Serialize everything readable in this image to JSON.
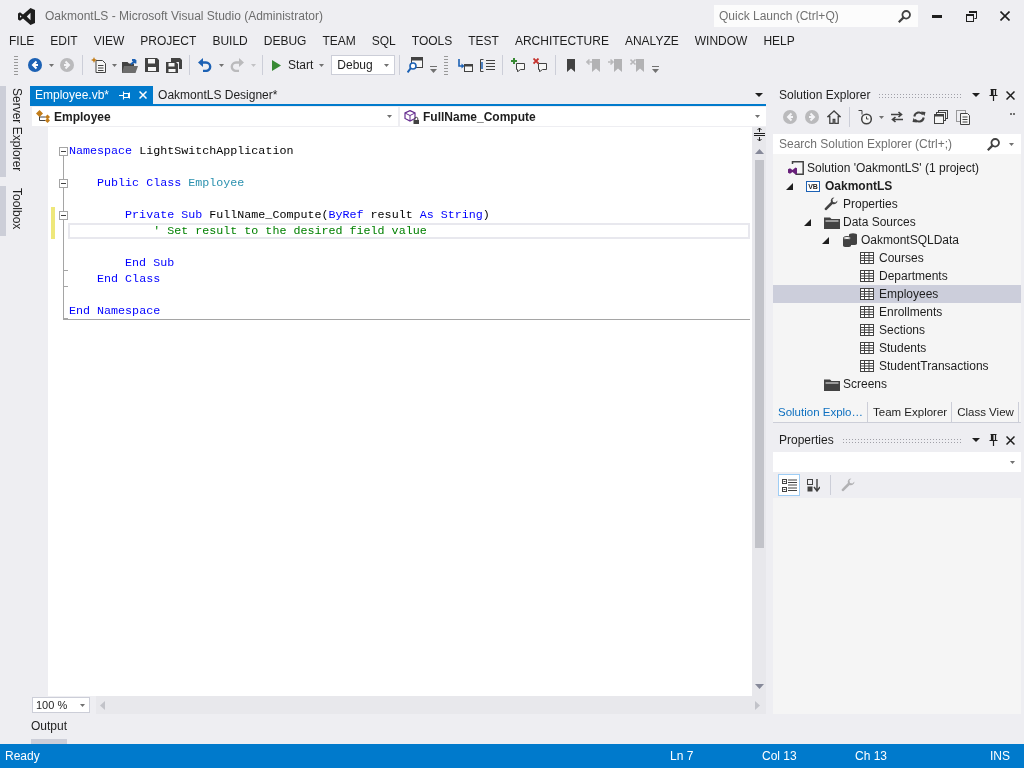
{
  "window": {
    "title": "OakmontLS - Microsoft Visual Studio (Administrator)"
  },
  "quick_launch": {
    "placeholder": "Quick Launch (Ctrl+Q)"
  },
  "menu": [
    "FILE",
    "EDIT",
    "VIEW",
    "PROJECT",
    "BUILD",
    "DEBUG",
    "TEAM",
    "SQL",
    "TOOLS",
    "TEST",
    "ARCHITECTURE",
    "ANALYZE",
    "WINDOW",
    "HELP"
  ],
  "toolbar": [
    {
      "kind": "grip"
    },
    {
      "kind": "back",
      "disabled": false
    },
    {
      "kind": "caret",
      "disabled": false
    },
    {
      "kind": "forward",
      "disabled": true
    },
    {
      "kind": "separator"
    },
    {
      "kind": "new_project",
      "disabled": false
    },
    {
      "kind": "caret",
      "disabled": false
    },
    {
      "kind": "open_file",
      "disabled": false
    },
    {
      "kind": "save",
      "disabled": false
    },
    {
      "kind": "save_all",
      "disabled": false
    },
    {
      "kind": "separator"
    },
    {
      "kind": "undo",
      "disabled": false
    },
    {
      "kind": "caret",
      "disabled": false
    },
    {
      "kind": "redo",
      "disabled": true
    },
    {
      "kind": "caret",
      "disabled": true
    },
    {
      "kind": "separator"
    },
    {
      "kind": "start",
      "label": "Start",
      "disabled": false
    },
    {
      "kind": "caret",
      "disabled": false
    },
    {
      "kind": "combo",
      "value": "Debug"
    },
    {
      "kind": "separator"
    },
    {
      "kind": "find",
      "disabled": false
    },
    {
      "kind": "overflow"
    },
    {
      "kind": "grip"
    },
    {
      "kind": "outdent",
      "disabled": false
    },
    {
      "kind": "indent",
      "disabled": false
    },
    {
      "kind": "separator"
    },
    {
      "kind": "comment",
      "disabled": false
    },
    {
      "kind": "uncomment",
      "disabled": false
    },
    {
      "kind": "separator"
    },
    {
      "kind": "bookmark",
      "disabled": false
    },
    {
      "kind": "previous_bookmark",
      "disabled": true
    },
    {
      "kind": "next_bookmark",
      "disabled": true
    },
    {
      "kind": "clear_bookmarks",
      "disabled": true
    },
    {
      "kind": "overflow"
    }
  ],
  "side_tabs": [
    "Server Explorer",
    "Toolbox"
  ],
  "editor": {
    "tabs": [
      {
        "label": "Employee.vb*",
        "selected": true
      },
      {
        "label": "OakmontLS Designer*",
        "selected": false
      }
    ],
    "type_dropdown": "Employee",
    "member_dropdown": "FullName_Compute",
    "code": [
      {
        "kind": "blank"
      },
      {
        "kind": "code",
        "changed": false,
        "current": false,
        "tokens": [
          {
            "kind": "keyword",
            "text": "Namespace"
          },
          {
            "kind": "plain",
            "text": " LightSwitchApplication"
          }
        ],
        "children": [
          {
            "kind": "blank"
          },
          {
            "kind": "code",
            "changed": false,
            "current": false,
            "tokens": [
              {
                "kind": "keyword",
                "text": "Public Class "
              },
              {
                "kind": "type",
                "text": "Employee"
              }
            ],
            "children": [
              {
                "kind": "blank"
              },
              {
                "kind": "code",
                "changed": true,
                "current": false,
                "tokens": [
                  {
                    "kind": "keyword",
                    "text": "Private Sub "
                  },
                  {
                    "kind": "plain",
                    "text": "FullName_Compute("
                  },
                  {
                    "kind": "keyword",
                    "text": "ByRef"
                  },
                  {
                    "kind": "plain",
                    "text": " result "
                  },
                  {
                    "kind": "keyword",
                    "text": "As String"
                  },
                  {
                    "kind": "plain",
                    "text": ")"
                  }
                ],
                "children": [
                  {
                    "kind": "code",
                    "changed": true,
                    "current": true,
                    "tokens": [
                      {
                        "kind": "comment",
                        "text": "' Set result to the desired field value"
                      }
                    ]
                  },
                  {
                    "kind": "blank"
                  }
                ]
              },
              {
                "kind": "code",
                "changed": false,
                "current": false,
                "tokens": [
                  {
                    "kind": "keyword",
                    "text": "End Sub"
                  }
                ]
              }
            ]
          },
          {
            "kind": "code",
            "changed": false,
            "current": false,
            "tokens": [
              {
                "kind": "keyword",
                "text": "End Class"
              }
            ]
          },
          {
            "kind": "blank"
          }
        ]
      },
      {
        "kind": "code",
        "changed": false,
        "current": false,
        "tokens": [
          {
            "kind": "keyword",
            "text": "End Namespace"
          }
        ]
      }
    ],
    "zoom": "100 %"
  },
  "bottom_tabs": [
    "Output"
  ],
  "solution_explorer": {
    "title": "Solution Explorer",
    "toolbar": [
      {
        "kind": "back",
        "disabled": true
      },
      {
        "kind": "forward",
        "disabled": true
      },
      {
        "kind": "home",
        "disabled": false
      },
      {
        "kind": "separator"
      },
      {
        "kind": "pending_changes",
        "disabled": false
      },
      {
        "kind": "caret",
        "disabled": false
      },
      {
        "kind": "sync",
        "disabled": false
      },
      {
        "kind": "refresh",
        "disabled": false
      },
      {
        "kind": "collapse_all",
        "disabled": false
      },
      {
        "kind": "properties",
        "disabled": false
      },
      {
        "kind": "more"
      }
    ],
    "search": {
      "placeholder": "Search Solution Explorer (Ctrl+;)"
    },
    "tree": [
      {
        "kind": "solution",
        "label": "Solution 'OakmontLS' (1 project)",
        "selected": false,
        "children": [
          {
            "kind": "project",
            "label": "OakmontLS",
            "icon_text": "VB",
            "selected": false,
            "expanded": true,
            "children": [
              {
                "kind": "properties",
                "label": "Properties",
                "selected": false
              },
              {
                "kind": "folder",
                "label": "Data Sources",
                "selected": false,
                "expanded": true,
                "children": [
                  {
                    "kind": "database",
                    "label": "OakmontSQLData",
                    "selected": false,
                    "expanded": true,
                    "children": [
                      {
                        "kind": "table",
                        "label": "Courses",
                        "selected": false
                      },
                      {
                        "kind": "table",
                        "label": "Departments",
                        "selected": false
                      },
                      {
                        "kind": "table",
                        "label": "Employees",
                        "selected": true
                      },
                      {
                        "kind": "table",
                        "label": "Enrollments",
                        "selected": false
                      },
                      {
                        "kind": "table",
                        "label": "Sections",
                        "selected": false
                      },
                      {
                        "kind": "table",
                        "label": "Students",
                        "selected": false
                      },
                      {
                        "kind": "table",
                        "label": "StudentTransactions",
                        "selected": false
                      }
                    ]
                  }
                ]
              },
              {
                "kind": "folder",
                "label": "Screens",
                "selected": false
              }
            ]
          }
        ]
      }
    ],
    "tabs": [
      {
        "label": "Solution Explo…",
        "selected": true
      },
      {
        "label": "Team Explorer",
        "selected": false
      },
      {
        "label": "Class View",
        "selected": false
      }
    ]
  },
  "properties": {
    "title": "Properties",
    "toolbar": [
      {
        "kind": "categorized",
        "selected": true
      },
      {
        "kind": "alphabetical",
        "selected": false
      },
      {
        "kind": "separator"
      },
      {
        "kind": "property_pages",
        "disabled": true
      }
    ]
  },
  "status_bar": {
    "message": "Ready",
    "line": "Ln 7",
    "column": "Col 13",
    "character": "Ch 13",
    "mode": "INS"
  }
}
